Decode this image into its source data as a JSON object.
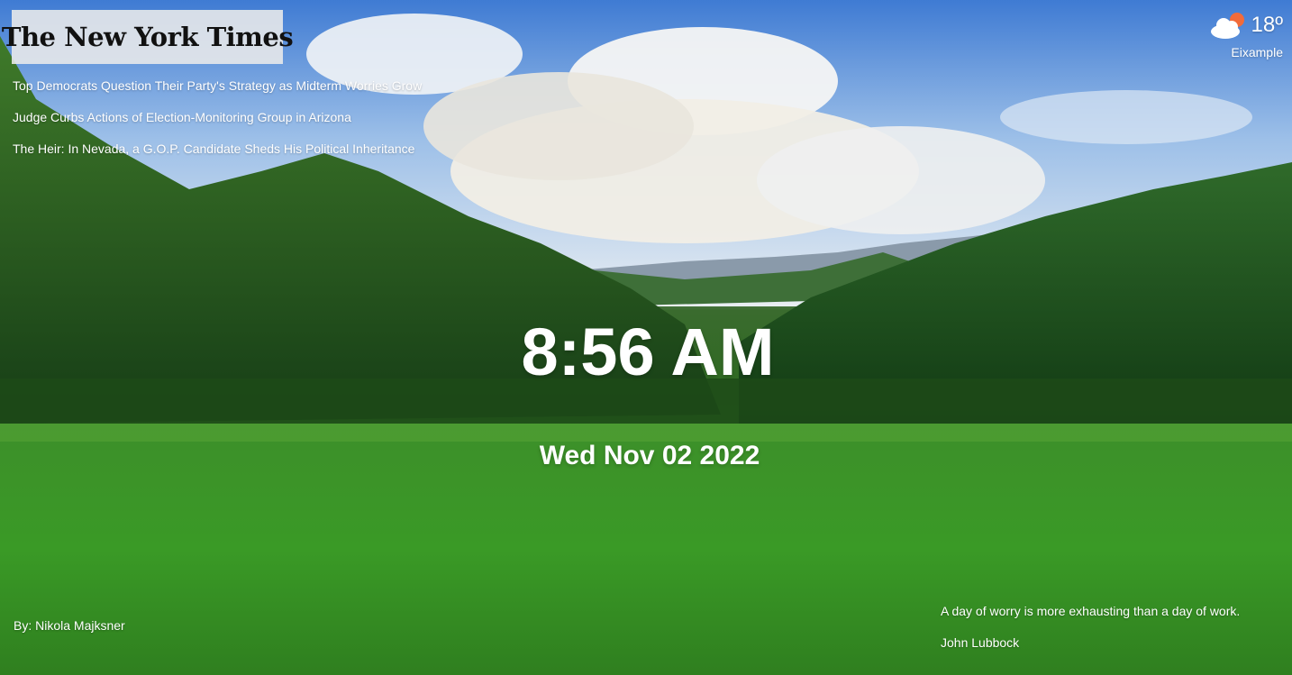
{
  "news": {
    "logo_text": "The New York Times",
    "headlines": [
      "Top Democrats Question Their Party's Strategy as Midterm Worries Grow",
      "Judge Curbs Actions of Election-Monitoring Group in Arizona",
      "The Heir: In Nevada, a G.O.P. Candidate Sheds His Political Inheritance"
    ]
  },
  "weather": {
    "icon": "partly-cloudy-icon",
    "temperature": "18º",
    "location": "Eixample"
  },
  "clock": {
    "time": "8:56 AM",
    "date": "Wed Nov 02 2022"
  },
  "background": {
    "credit": "By: Nikola Majksner"
  },
  "quote": {
    "text": "A day of worry is more exhausting than a day of work.",
    "author": "John Lubbock"
  },
  "colors": {
    "text": "#ffffff",
    "sun": "#f26b3a",
    "logo_box": "#ebebeb"
  }
}
